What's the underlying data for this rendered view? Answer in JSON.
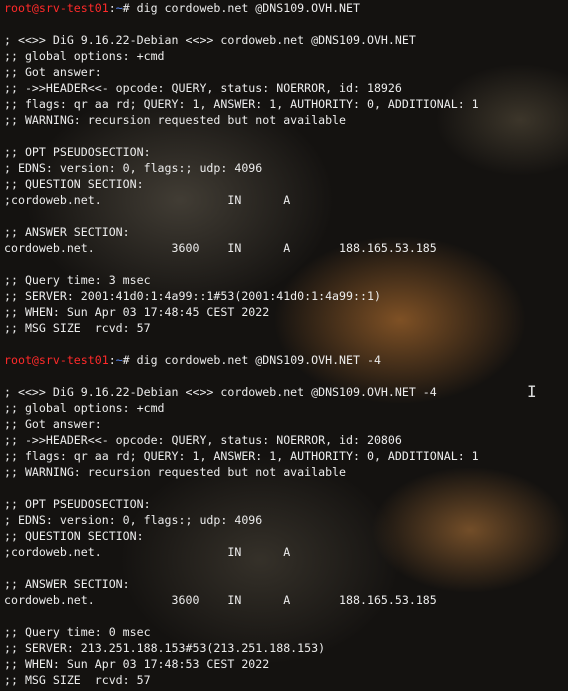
{
  "terminal": {
    "prompt": {
      "user_host": "root@srv-test01",
      "separator": ":",
      "path": "~",
      "symbol": "# "
    },
    "lines": [
      {
        "type": "prompt",
        "cmd": "dig cordoweb.net @DNS109.OVH.NET"
      },
      {
        "type": "text",
        "text": ""
      },
      {
        "type": "text",
        "text": "; <<>> DiG 9.16.22-Debian <<>> cordoweb.net @DNS109.OVH.NET"
      },
      {
        "type": "text",
        "text": ";; global options: +cmd"
      },
      {
        "type": "text",
        "text": ";; Got answer:"
      },
      {
        "type": "text",
        "text": ";; ->>HEADER<<- opcode: QUERY, status: NOERROR, id: 18926"
      },
      {
        "type": "text",
        "text": ";; flags: qr aa rd; QUERY: 1, ANSWER: 1, AUTHORITY: 0, ADDITIONAL: 1"
      },
      {
        "type": "text",
        "text": ";; WARNING: recursion requested but not available"
      },
      {
        "type": "text",
        "text": ""
      },
      {
        "type": "text",
        "text": ";; OPT PSEUDOSECTION:"
      },
      {
        "type": "text",
        "text": "; EDNS: version: 0, flags:; udp: 4096"
      },
      {
        "type": "text",
        "text": ";; QUESTION SECTION:"
      },
      {
        "type": "text",
        "text": ";cordoweb.net.                  IN      A"
      },
      {
        "type": "text",
        "text": ""
      },
      {
        "type": "text",
        "text": ";; ANSWER SECTION:"
      },
      {
        "type": "text",
        "text": "cordoweb.net.           3600    IN      A       188.165.53.185"
      },
      {
        "type": "text",
        "text": ""
      },
      {
        "type": "text",
        "text": ";; Query time: 3 msec"
      },
      {
        "type": "text",
        "text": ";; SERVER: 2001:41d0:1:4a99::1#53(2001:41d0:1:4a99::1)"
      },
      {
        "type": "text",
        "text": ";; WHEN: Sun Apr 03 17:48:45 CEST 2022"
      },
      {
        "type": "text",
        "text": ";; MSG SIZE  rcvd: 57"
      },
      {
        "type": "text",
        "text": ""
      },
      {
        "type": "prompt",
        "cmd": "dig cordoweb.net @DNS109.OVH.NET -4"
      },
      {
        "type": "text",
        "text": ""
      },
      {
        "type": "text",
        "text": "; <<>> DiG 9.16.22-Debian <<>> cordoweb.net @DNS109.OVH.NET -4"
      },
      {
        "type": "text",
        "text": ";; global options: +cmd"
      },
      {
        "type": "text",
        "text": ";; Got answer:"
      },
      {
        "type": "text",
        "text": ";; ->>HEADER<<- opcode: QUERY, status: NOERROR, id: 20806"
      },
      {
        "type": "text",
        "text": ";; flags: qr aa rd; QUERY: 1, ANSWER: 1, AUTHORITY: 0, ADDITIONAL: 1"
      },
      {
        "type": "text",
        "text": ";; WARNING: recursion requested but not available"
      },
      {
        "type": "text",
        "text": ""
      },
      {
        "type": "text",
        "text": ";; OPT PSEUDOSECTION:"
      },
      {
        "type": "text",
        "text": "; EDNS: version: 0, flags:; udp: 4096"
      },
      {
        "type": "text",
        "text": ";; QUESTION SECTION:"
      },
      {
        "type": "text",
        "text": ";cordoweb.net.                  IN      A"
      },
      {
        "type": "text",
        "text": ""
      },
      {
        "type": "text",
        "text": ";; ANSWER SECTION:"
      },
      {
        "type": "text",
        "text": "cordoweb.net.           3600    IN      A       188.165.53.185"
      },
      {
        "type": "text",
        "text": ""
      },
      {
        "type": "text",
        "text": ";; Query time: 0 msec"
      },
      {
        "type": "text",
        "text": ";; SERVER: 213.251.188.153#53(213.251.188.153)"
      },
      {
        "type": "text",
        "text": ";; WHEN: Sun Apr 03 17:48:53 CEST 2022"
      },
      {
        "type": "text",
        "text": ";; MSG SIZE  rcvd: 57"
      }
    ]
  },
  "cursor": {
    "icon": "text-ibeam-cursor-icon",
    "glyph": "I"
  },
  "colors": {
    "user_host": "#ff2a2a",
    "path": "#5a8cff",
    "text": "#ececec"
  }
}
